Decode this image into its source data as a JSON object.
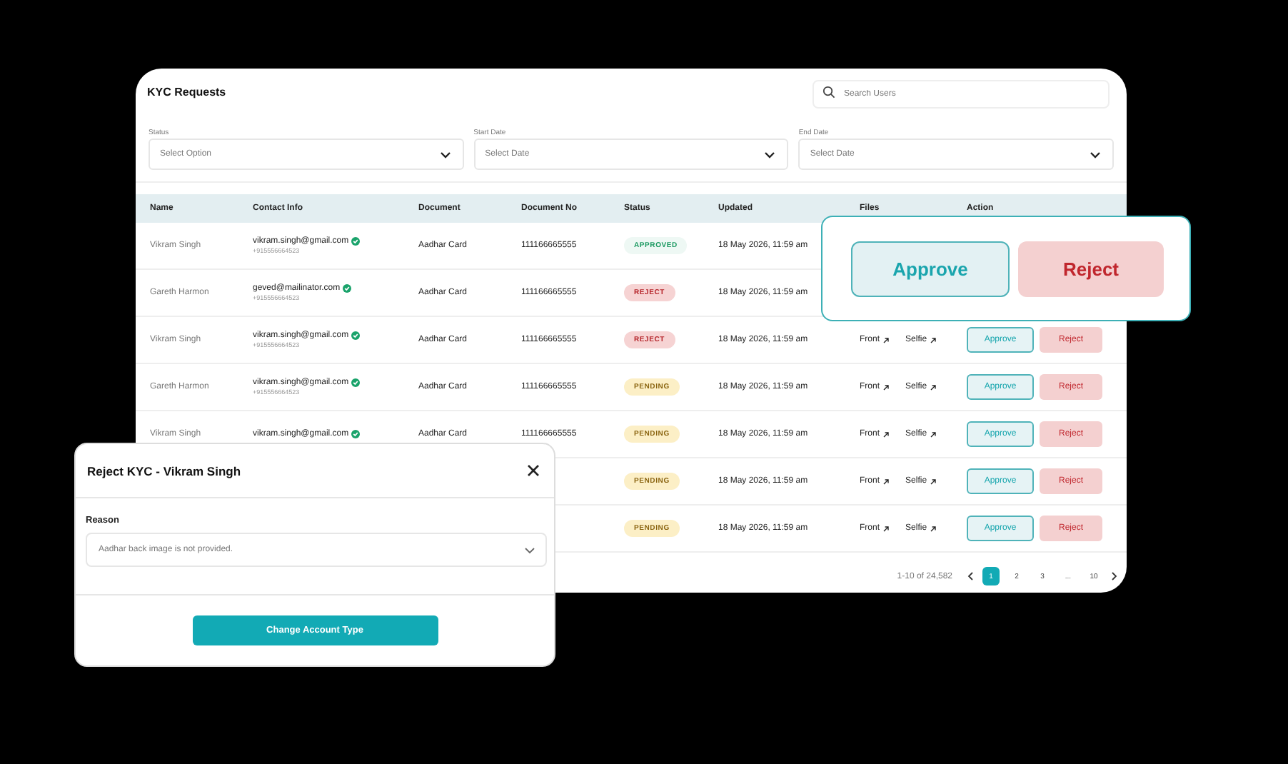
{
  "page": {
    "title": "KYC Requests",
    "search": {
      "placeholder": "Search Users"
    },
    "filters": [
      {
        "label": "Status",
        "placeholder": "Select Option"
      },
      {
        "label": "Start Date",
        "placeholder": "Select Date"
      },
      {
        "label": "End Date",
        "placeholder": "Select Date"
      }
    ],
    "table": {
      "columns": [
        "Name",
        "Contact Info",
        "Document",
        "Document No",
        "Status",
        "Updated",
        "Files",
        "Action"
      ],
      "rows": [
        {
          "name": "Vikram Singh",
          "email": "vikram.singh@gmail.com",
          "verified": true,
          "phone": "+915556664523",
          "document": "Aadhar Card",
          "document_no": "111166665555",
          "status": {
            "label": "APPROVED",
            "kind": "approved"
          },
          "updated": "18 May 2026, 11:59 am"
        },
        {
          "name": "Gareth Harmon",
          "email": "geved@mailinator.com",
          "verified": true,
          "phone": "+915556664523",
          "document": "Aadhar Card",
          "document_no": "111166665555",
          "status": {
            "label": "REJECT",
            "kind": "reject"
          },
          "updated": "18 May 2026, 11:59 am"
        },
        {
          "name": "Vikram Singh",
          "email": "vikram.singh@gmail.com",
          "verified": true,
          "phone": "+915556664523",
          "document": "Aadhar Card",
          "document_no": "111166665555",
          "status": {
            "label": "REJECT",
            "kind": "reject"
          },
          "updated": "18 May 2026, 11:59 am",
          "files": [
            "Front",
            "Selfie"
          ],
          "actions": [
            "Approve",
            "Reject"
          ]
        },
        {
          "name": "Gareth Harmon",
          "email": "vikram.singh@gmail.com",
          "verified": true,
          "phone": "+915556664523",
          "document": "Aadhar Card",
          "document_no": "111166665555",
          "status": {
            "label": "PENDING",
            "kind": "pending"
          },
          "updated": "18 May 2026, 11:59 am",
          "files": [
            "Front",
            "Selfie"
          ],
          "actions": [
            "Approve",
            "Reject"
          ]
        },
        {
          "name": "Vikram Singh",
          "email": "vikram.singh@gmail.com",
          "verified": true,
          "document": "Aadhar Card",
          "document_no": "111166665555",
          "status": {
            "label": "PENDING",
            "kind": "pending"
          },
          "updated": "18 May 2026, 11:59 am",
          "files": [
            "Front",
            "Selfie"
          ],
          "actions": [
            "Approve",
            "Reject"
          ]
        },
        {
          "status": {
            "label": "PENDING",
            "kind": "pending"
          },
          "updated": "18 May 2026, 11:59 am",
          "files": [
            "Front",
            "Selfie"
          ],
          "actions": [
            "Approve",
            "Reject"
          ]
        },
        {
          "status": {
            "label": "PENDING",
            "kind": "pending"
          },
          "updated": "18 May 2026, 11:59 am",
          "files": [
            "Front",
            "Selfie"
          ],
          "actions": [
            "Approve",
            "Reject"
          ]
        }
      ]
    },
    "pagination": {
      "range": "1-10 of 24,582",
      "pages": [
        {
          "label": "1",
          "selected": true
        },
        {
          "label": "2",
          "selected": false
        },
        {
          "label": "3",
          "selected": false
        },
        {
          "label": "...",
          "selected": false
        },
        {
          "label": "10",
          "selected": false
        }
      ]
    }
  },
  "action_popup": {
    "buttons": [
      {
        "label": "Approve",
        "kind": "approve"
      },
      {
        "label": "Reject",
        "kind": "reject"
      }
    ]
  },
  "reject_dialog": {
    "title": "Reject KYC - Vikram Singh",
    "field_label": "Reason",
    "value": "Aadhar back image is not provided.",
    "button": "Change Account Type"
  }
}
